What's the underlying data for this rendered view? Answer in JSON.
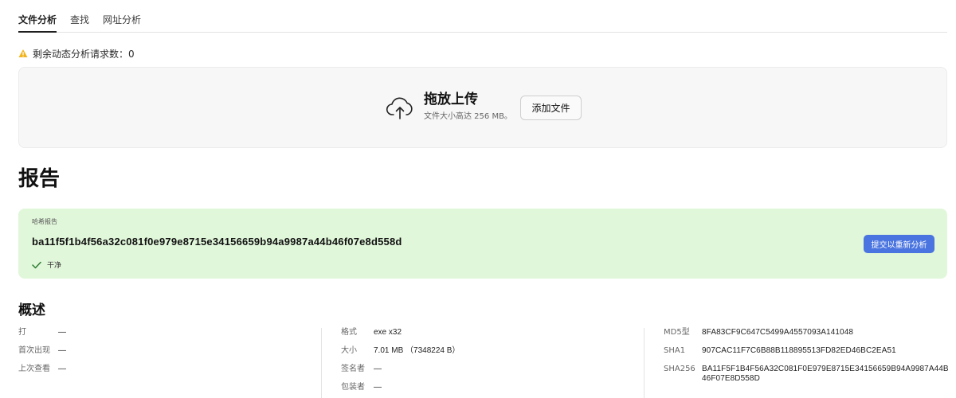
{
  "tabs": [
    {
      "label": "文件分析",
      "active": true
    },
    {
      "label": "查找",
      "active": false
    },
    {
      "label": "网址分析",
      "active": false
    }
  ],
  "warning": {
    "text": "剩余动态分析请求数：0",
    "icon": "warning-triangle-icon",
    "color": "#f2b41d"
  },
  "upload": {
    "icon": "cloud-upload-icon",
    "title": "拖放上传",
    "subtitle": "文件大小高达 256 MB。",
    "add_button": "添加文件"
  },
  "report": {
    "title": "报告"
  },
  "hash_report": {
    "label": "哈希报告",
    "hash": "ba11f5f1b4f56a32c081f0e979e8715e34156659b94a9987a44b46f07e8d558d",
    "status": "干净",
    "status_icon": "check-icon",
    "resubmit_button": "提交以重新分析",
    "bg_color": "#e1f7da",
    "button_color": "#4a74e0"
  },
  "overview": {
    "title": "概述",
    "col1": [
      {
        "key": "打",
        "value": "—"
      },
      {
        "key": "首次出现",
        "value": "—"
      },
      {
        "key": "上次查看",
        "value": "—"
      }
    ],
    "col2": [
      {
        "key": "格式",
        "value": "exe x32"
      },
      {
        "key": "大小",
        "value": "7.01 MB （7348224 B）"
      },
      {
        "key": "签名者",
        "value": "—"
      },
      {
        "key": "包装者",
        "value": "—"
      }
    ],
    "col3": [
      {
        "key": "MD5型",
        "value": "8FA83CF9C647C5499A4557093A141048"
      },
      {
        "key": "SHA1",
        "value": "907CAC11F7C6B88B118895513FD82ED46BC2EA51"
      },
      {
        "key": "SHA256",
        "value": "BA11F5F1B4F56A32C081F0E979E8715E34156659B94A9987A44B46F07E8D558D"
      }
    ]
  }
}
